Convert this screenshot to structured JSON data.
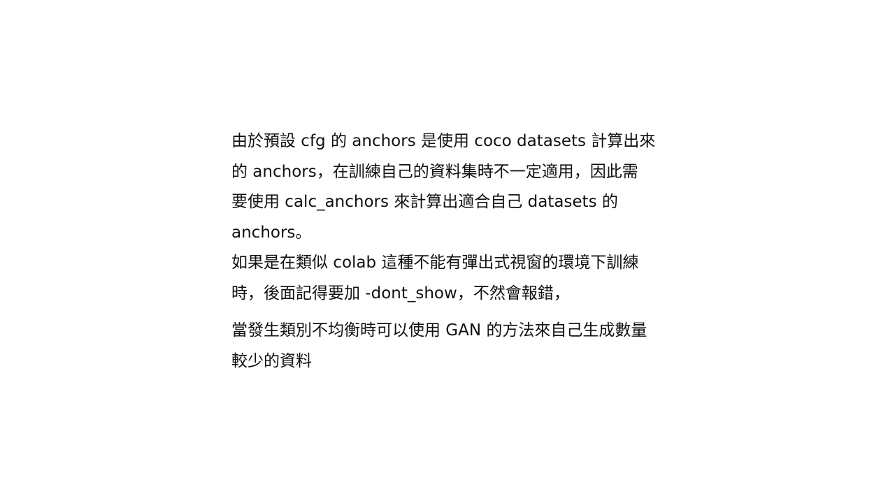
{
  "paragraphs": [
    {
      "lines": [
        "由於預設 cfg 的 anchors 是使用 coco datasets 計算出來",
        "的 anchors，在訓練自己的資料集時不一定適用，因此需",
        "要使用 calc_anchors 來計算出適合自己 datasets 的",
        "anchors。"
      ]
    },
    {
      "lines": [
        "如果是在類似 colab 這種不能有彈出式視窗的環境下訓練",
        "時，後面記得要加 -dont_show，不然會報錯，"
      ]
    },
    {
      "lines": [
        "當發生類別不均衡時可以使用 GAN 的方法來自己生成數量",
        "較少的資料"
      ]
    }
  ]
}
